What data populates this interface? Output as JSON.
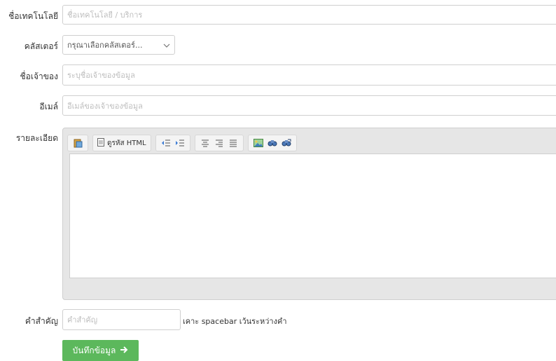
{
  "form": {
    "tech_name": {
      "label": "ชื่อเทคโนโลยี",
      "placeholder": "ชื่อเทคโนโลยี / บริการ"
    },
    "cluster": {
      "label": "คลัสเตอร์",
      "selected": "กรุณาเลือกคลัสเตอร์..."
    },
    "owner": {
      "label": "ชื่อเจ้าของ",
      "placeholder": "ระบุชื่อเจ้าของข้อมูล"
    },
    "email": {
      "label": "อีเมล์",
      "placeholder": "อีเมล์ของเจ้าของข้อมูล"
    },
    "details": {
      "label": "รายละเอียด",
      "toolbar": {
        "html_code_label": "ดูรหัส HTML"
      }
    },
    "keywords": {
      "label": "คำสำคัญ",
      "placeholder": "คำสำคัญ",
      "hint": "เคาะ spacebar เว้นระหว่างคำ"
    },
    "save_button": {
      "label": "บันทึกข้อมูล",
      "icon": "arrow-right-icon",
      "color": "#5cb85c"
    }
  }
}
